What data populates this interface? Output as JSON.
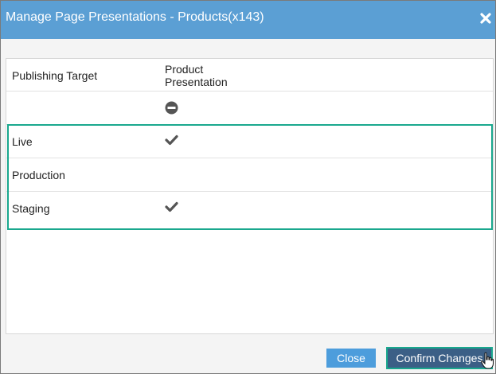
{
  "dialog": {
    "title": "Manage Page Presentations - Products(x143)",
    "close_icon": "close-x-icon"
  },
  "table": {
    "columns": [
      "Publishing Target",
      "Product Presentation"
    ],
    "header": {
      "col1": "Publishing Target",
      "col2_line1": "Product",
      "col2_line2": "Presentation"
    },
    "rows": [
      {
        "target": "",
        "status": "none",
        "icon": "minus-circle-icon"
      },
      {
        "target": "Live",
        "status": "checked",
        "icon": "check-icon"
      },
      {
        "target": "Production",
        "status": "empty",
        "icon": ""
      },
      {
        "target": "Staging",
        "status": "checked",
        "icon": "check-icon"
      }
    ]
  },
  "footer": {
    "close_label": "Close",
    "confirm_label": "Confirm Changes"
  },
  "colors": {
    "titlebar": "#5b9fd4",
    "highlight": "#1aa88e",
    "close_button": "#4d9ddc",
    "confirm_button": "#3b5f86",
    "icon": "#555555"
  }
}
